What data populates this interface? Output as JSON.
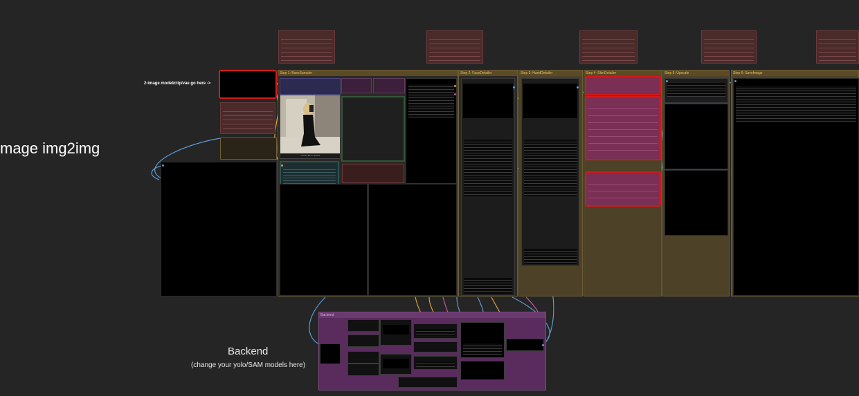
{
  "canvas": {
    "background": "#252525"
  },
  "labels": {
    "title_partial": "mage img2img",
    "load_hint": "2-image model/clip/vae go here ->",
    "backend_title": "Backend",
    "backend_subtitle": "(change your yolo/SAM models here)",
    "upload_caption": "choose file to upload"
  },
  "groups": [
    {
      "key": "step1",
      "title": "Step 1: BaseSampler"
    },
    {
      "key": "step2",
      "title": "Step 2: FaceDetailer"
    },
    {
      "key": "step3",
      "title": "Step 3: HandDetailer"
    },
    {
      "key": "step4",
      "title": "Step 4: SkinDetailer"
    },
    {
      "key": "step5",
      "title": "Step 5: Upscale"
    },
    {
      "key": "step6",
      "title": "Step 6: SaveImage"
    },
    {
      "key": "backend",
      "title": "Backend"
    }
  ],
  "colors": {
    "group_gold": "#4d4228",
    "group_gold_border": "#6e5e34",
    "group_purple": "#5a2c5e",
    "node_red": "#4b2a2a",
    "node_pink": "#7a2f55",
    "selected_red": "#d11a1a",
    "link_blue": "#5d9bd1",
    "link_gold": "#d5a545",
    "link_pink": "#c45b9c"
  }
}
